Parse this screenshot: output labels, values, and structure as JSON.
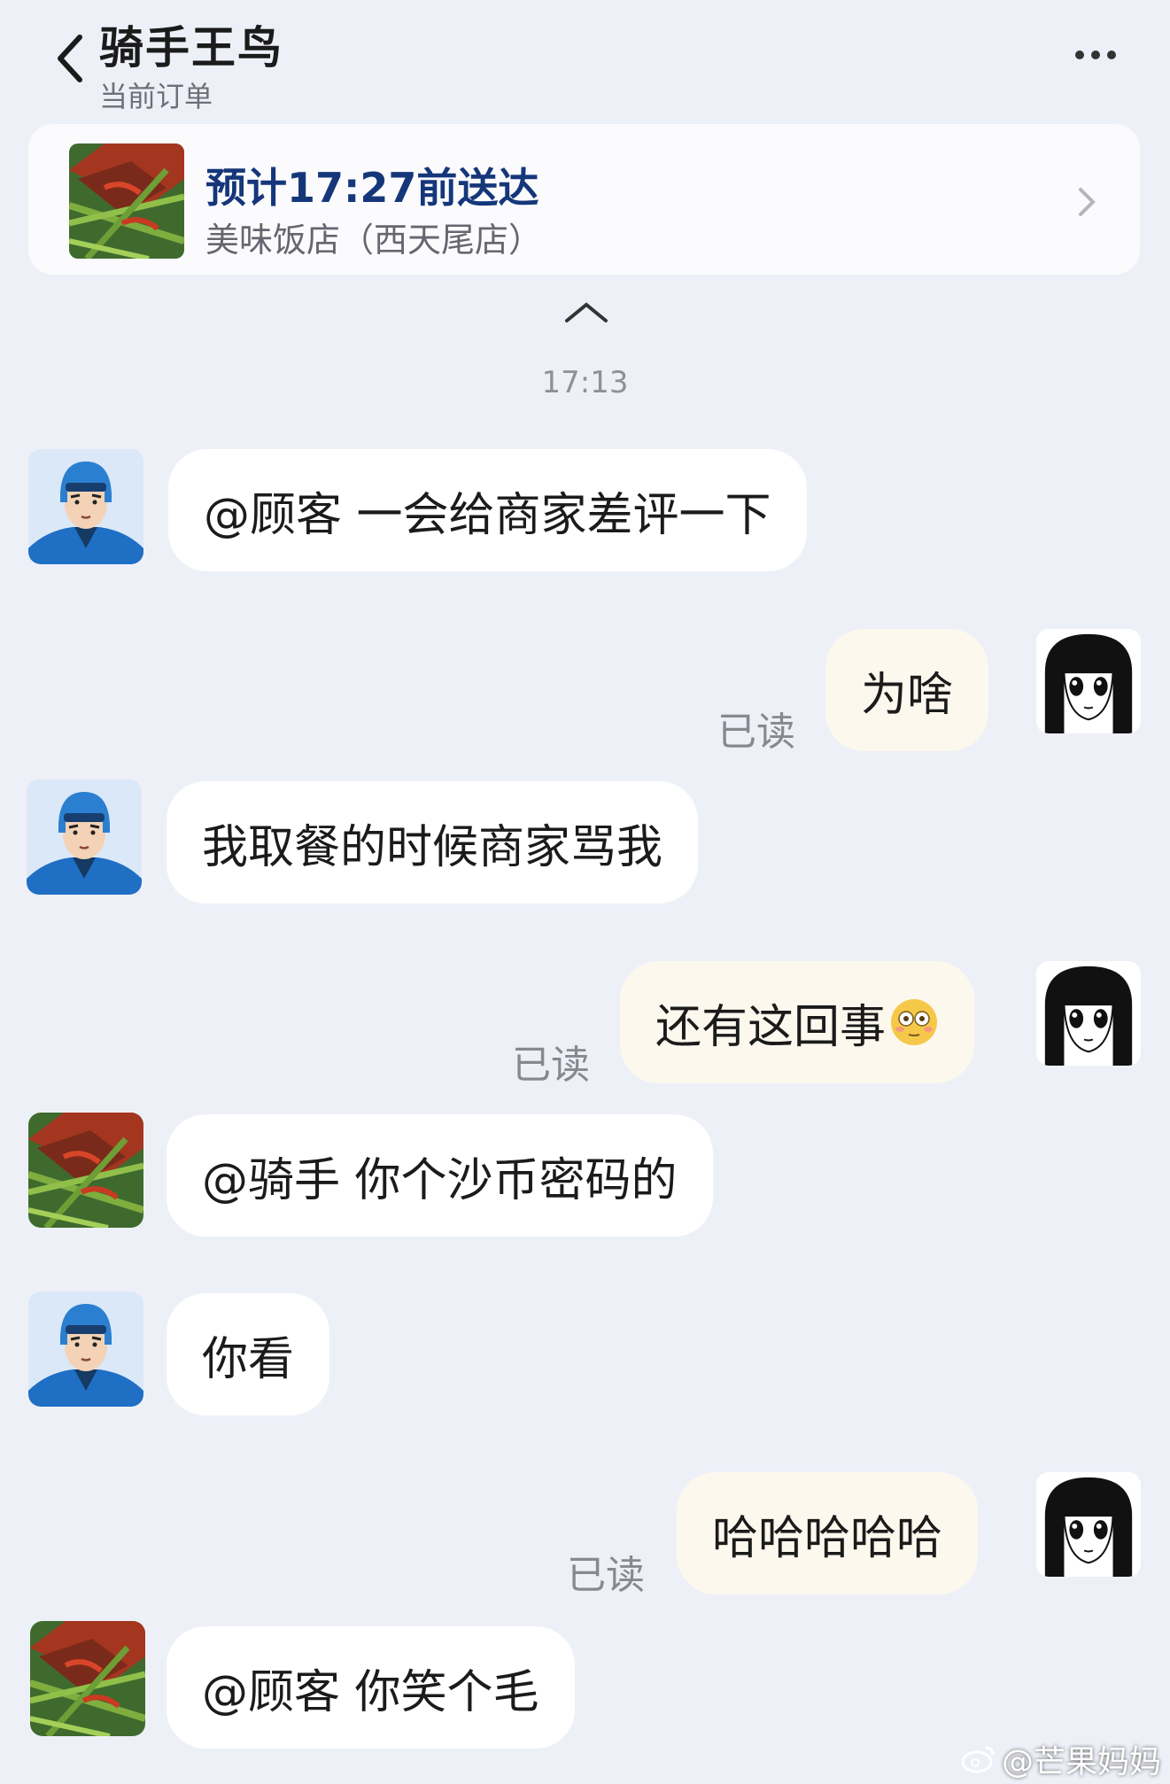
{
  "header": {
    "title": "骑手王鸟",
    "subtitle": "当前订单"
  },
  "order": {
    "eta": "预计17:27前送达",
    "shop": "美味饭店（西天尾店）"
  },
  "timestamp": "17:13",
  "messages": [
    {
      "sender": "rider",
      "text": "@顾客 一会给商家差评一下"
    },
    {
      "sender": "customer",
      "text": "为啥",
      "status": "已读"
    },
    {
      "sender": "rider",
      "text": "我取餐的时候商家骂我"
    },
    {
      "sender": "customer",
      "text": "还有这回事",
      "emoji": "flushed-face",
      "status": "已读"
    },
    {
      "sender": "merchant",
      "text": "@骑手 你个沙币密码的"
    },
    {
      "sender": "rider",
      "text": "你看"
    },
    {
      "sender": "customer",
      "text": "哈哈哈哈哈",
      "status": "已读"
    },
    {
      "sender": "merchant",
      "text": "@顾客 你笑个毛"
    }
  ],
  "watermark": "@芒果妈妈",
  "colors": {
    "background": "#eef0f8",
    "eta_text": "#15377a",
    "left_bubble": "#ffffff",
    "right_bubble": "#fdf8ee",
    "rider_helmet": "#2b7fd0"
  }
}
